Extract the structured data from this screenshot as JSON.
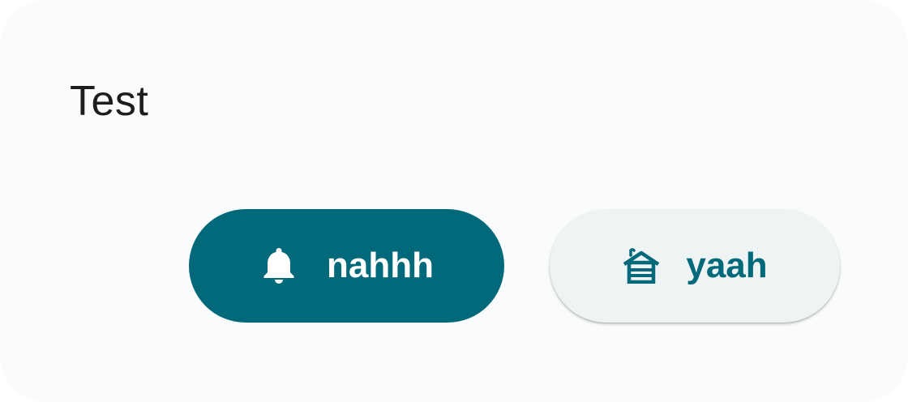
{
  "dialog": {
    "title": "Test",
    "dismiss_button": {
      "label": "nahhh",
      "icon": "bell-icon"
    },
    "confirm_button": {
      "label": "yaah",
      "icon": "cabin-icon"
    }
  },
  "colors": {
    "surface": "#f9fbfc",
    "primary": "#02697a",
    "on_primary": "#ffffff",
    "tonal_surface": "#eef3f4",
    "title_text": "#1c1d1f"
  }
}
